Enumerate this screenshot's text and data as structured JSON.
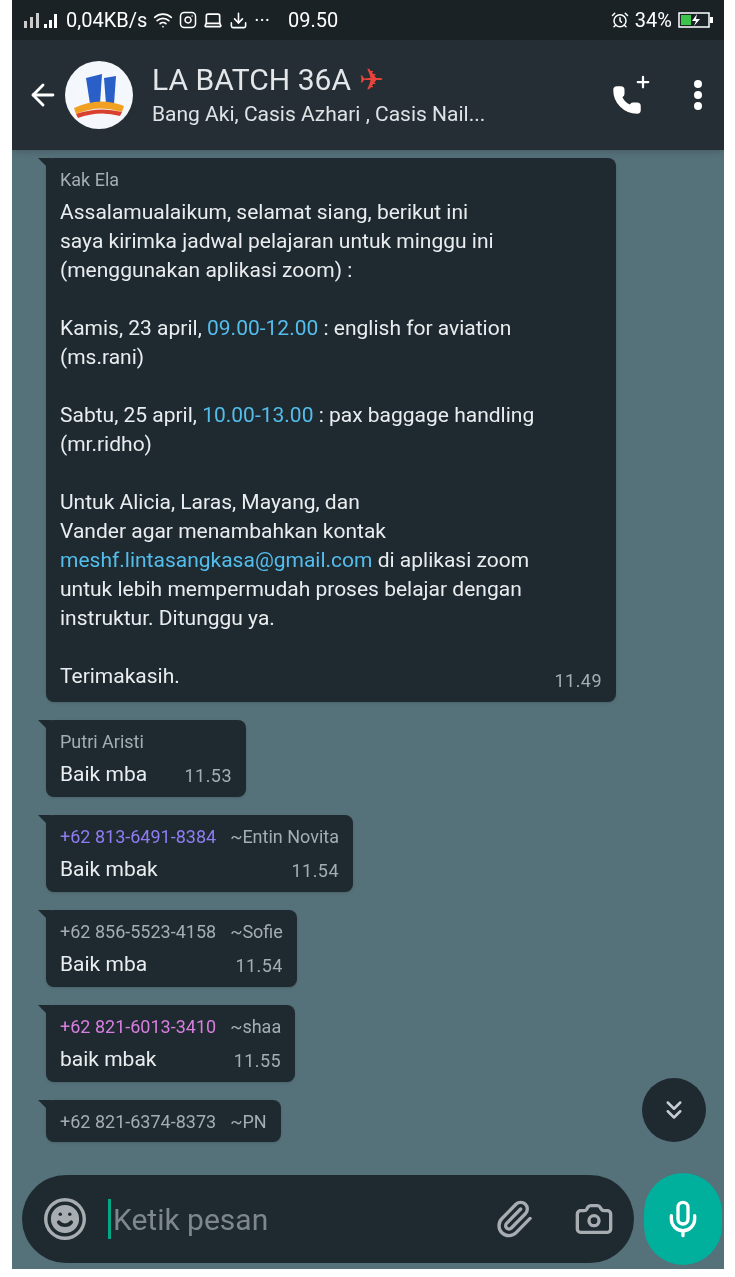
{
  "status_bar": {
    "speed": "0,04KB/s",
    "dots": "···",
    "time": "09.50",
    "battery": "34%"
  },
  "header": {
    "title": "LA BATCH 36A",
    "title_emoji": "✈",
    "subtitle": "Bang Aki, Casis Azhari , Casis Nail..."
  },
  "messages": [
    {
      "sender": "Kak Ela",
      "color": "#a3adb2",
      "time": "11.49",
      "paragraphs": [
        [
          {
            "kind": "text",
            "text": "Assalamualaikum, selamat siang, berikut ini\nsaya kirimka jadwal pelajaran untuk minggu ini\n(menggunakan aplikasi zoom) :"
          }
        ],
        [
          {
            "kind": "text",
            "text": "Kamis, 23 april, "
          },
          {
            "kind": "link",
            "text": "09.00-12.00"
          },
          {
            "kind": "text",
            "text": " : english for aviation\n(ms.rani)"
          }
        ],
        [
          {
            "kind": "text",
            "text": "Sabtu, 25 april, "
          },
          {
            "kind": "link",
            "text": "10.00-13.00"
          },
          {
            "kind": "text",
            "text": " : pax baggage handling\n(mr.ridho)"
          }
        ],
        [
          {
            "kind": "text",
            "text": "Untuk Alicia, Laras, Mayang, dan\nVander agar menambahkan kontak\n"
          },
          {
            "kind": "link",
            "text": "meshf.lintasangkasa@gmail.com"
          },
          {
            "kind": "text",
            "text": " di aplikasi zoom\nuntuk lebih mempermudah proses belajar dengan\ninstruktur. Ditunggu ya."
          }
        ],
        [
          {
            "kind": "text",
            "text": "Terimakasih."
          }
        ]
      ]
    },
    {
      "sender": "Putri Aristi",
      "color": "#a3adb2",
      "time": "11.53",
      "paragraphs": [
        [
          {
            "kind": "text",
            "text": "Baik mba"
          }
        ]
      ]
    },
    {
      "sender": "+62 813-6491-8384",
      "nickname": "~Entin Novita",
      "color": "#8f7cf2",
      "time": "11.54",
      "paragraphs": [
        [
          {
            "kind": "text",
            "text": "Baik mbak"
          }
        ]
      ]
    },
    {
      "sender": "+62 856-5523-4158",
      "nickname": "~Sofie",
      "color": "#a3adb2",
      "time": "11.54",
      "paragraphs": [
        [
          {
            "kind": "text",
            "text": "Baik mba"
          }
        ]
      ]
    },
    {
      "sender": "+62 821-6013-3410",
      "nickname": "~shaa",
      "color": "#d77ee0",
      "time": "11.55",
      "paragraphs": [
        [
          {
            "kind": "text",
            "text": "baik mbak"
          }
        ]
      ]
    },
    {
      "sender": "+62 821-6374-8373",
      "nickname": "~PN",
      "color": "#a3adb2"
    }
  ],
  "composer": {
    "placeholder": "Ketik pesan"
  }
}
